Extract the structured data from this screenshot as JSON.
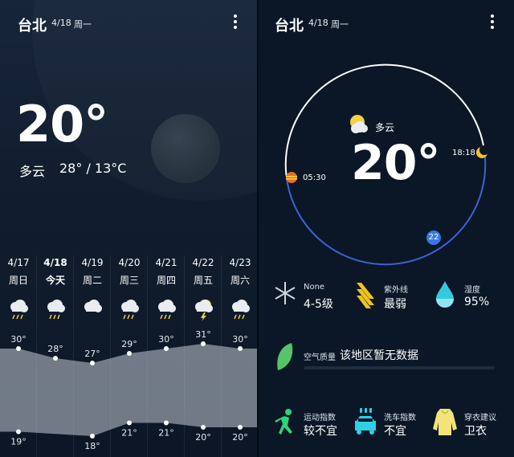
{
  "left_panel": {
    "city": "台北",
    "date": "4/18",
    "weekday": "周一",
    "current_temp": "20°",
    "condition": "多云",
    "temp_range": "28° / 13°C",
    "forecast": [
      {
        "date": "4/17",
        "day": "周日",
        "high": "30°",
        "low": "19°",
        "icon": "cloud-rain-icon"
      },
      {
        "date": "4/18",
        "day": "今天",
        "high": "28°",
        "low": "",
        "icon": "cloud-rain-icon"
      },
      {
        "date": "4/19",
        "day": "周二",
        "high": "27°",
        "low": "18°",
        "icon": "cloud-icon"
      },
      {
        "date": "4/20",
        "day": "周三",
        "high": "29°",
        "low": "21°",
        "icon": "cloud-rain-icon"
      },
      {
        "date": "4/21",
        "day": "周四",
        "high": "30°",
        "low": "21°",
        "icon": "cloud-rain-icon"
      },
      {
        "date": "4/22",
        "day": "周五",
        "high": "31°",
        "low": "20°",
        "icon": "thunder-cloud-icon"
      },
      {
        "date": "4/23",
        "day": "周六",
        "high": "30°",
        "low": "20°",
        "icon": "cloud-rain-icon"
      }
    ]
  },
  "right_panel": {
    "city": "台北",
    "date": "4/18",
    "weekday": "周一",
    "condition": "多云",
    "current_temp": "20°",
    "sunrise": "05:30",
    "sunset": "18:18",
    "day_marker": "22",
    "wind": {
      "label": "None",
      "value": "4-5级"
    },
    "uv": {
      "label": "紫外线",
      "value": "最弱"
    },
    "humidity": {
      "label": "湿度",
      "value": "95%"
    },
    "air_quality": {
      "label": "空气质量",
      "value": "该地区暂无数据"
    },
    "sport": {
      "label": "运动指数",
      "value": "较不宜"
    },
    "carwash": {
      "label": "洗车指数",
      "value": "不宜"
    },
    "dressing": {
      "label": "穿衣建议",
      "value": "卫衣"
    }
  },
  "colors": {
    "accent_blue": "#3578e5",
    "leaf_green": "#55c46a",
    "uv_yellow": "#f0c419",
    "humidity_cyan": "#35c9e0",
    "sport_green": "#2ed47a",
    "car_cyan": "#2fd0e6",
    "coat_yellow": "#f4e27a"
  }
}
